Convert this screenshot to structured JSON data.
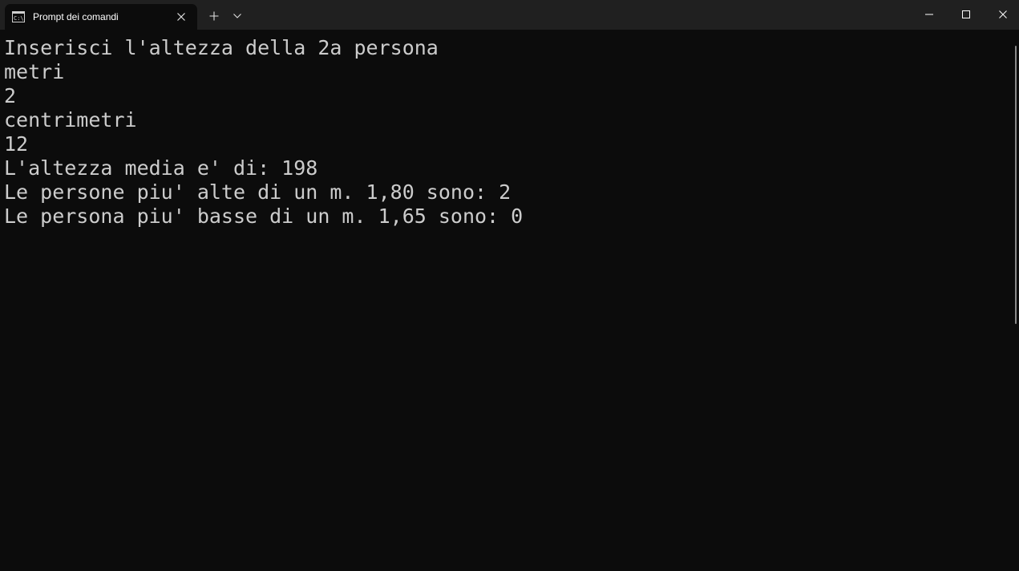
{
  "window": {
    "tab_title": "Prompt dei comandi",
    "tab_icon": "cmd-icon",
    "accent": "#0c0c0c",
    "titlebar_bg": "#202020",
    "text_color": "#cccccc"
  },
  "controls": {
    "new_tab_icon": "plus-icon",
    "dropdown_icon": "chevron-down-icon",
    "close_tab_icon": "close-icon",
    "minimize_icon": "minimize-icon",
    "maximize_icon": "maximize-icon",
    "close_window_icon": "close-icon"
  },
  "terminal": {
    "lines": [
      "Inserisci l'altezza della 2a persona",
      "metri",
      "2",
      "centrimetri",
      "12",
      "L'altezza media e' di: 198",
      "Le persone piu' alte di un m. 1,80 sono: 2",
      "Le persona piu' basse di un m. 1,65 sono: 0"
    ]
  }
}
